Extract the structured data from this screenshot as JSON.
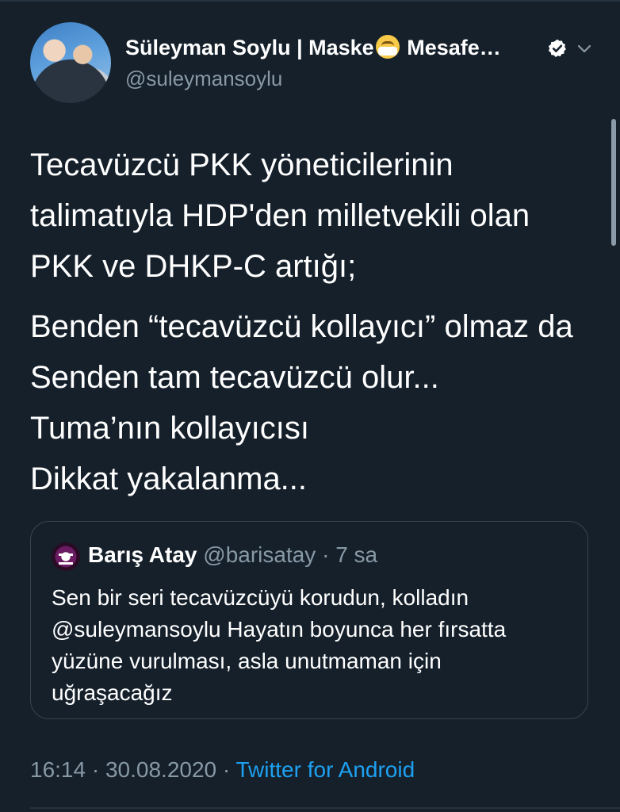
{
  "author": {
    "display_name_prefix": "Süleyman Soylu | Maske",
    "display_name_emoji": "mask-face-emoji",
    "display_name_suffix": "Mesafe…",
    "handle": "@suleymansoylu",
    "verified_icon": "verified-badge-icon",
    "menu_icon": "chevron-down-icon"
  },
  "tweet": {
    "paragraph1": "Tecavüzcü PKK yöneticilerinin talimatıyla HDP'den milletvekili olan PKK ve DHKP-C artığı;",
    "line1": "Benden “tecavüzcü kollayıcı” olmaz da",
    "line2": "Senden tam tecavüzcü olur...",
    "line3": "Tuma’nın kollayıcısı",
    "line4": "Dikkat yakalanma..."
  },
  "quoted_tweet": {
    "name": "Barış Atay",
    "handle": "@barisatay",
    "separator": "·",
    "time": "7 sa",
    "text": "Sen bir seri tecavüzcüyü korudun, kolladın @suleymansoylu Hayatın boyunca her fırsatta yüzüne vurulması, asla unutmaman için uğraşacağız"
  },
  "footer": {
    "time": "16:14",
    "separator1": "·",
    "date": "30.08.2020",
    "separator2": "·",
    "source": "Twitter for Android"
  },
  "colors": {
    "background": "#15202b",
    "text_primary": "#ffffff",
    "text_secondary": "#8899a6",
    "link": "#1da1f2",
    "border": "#38444d"
  }
}
